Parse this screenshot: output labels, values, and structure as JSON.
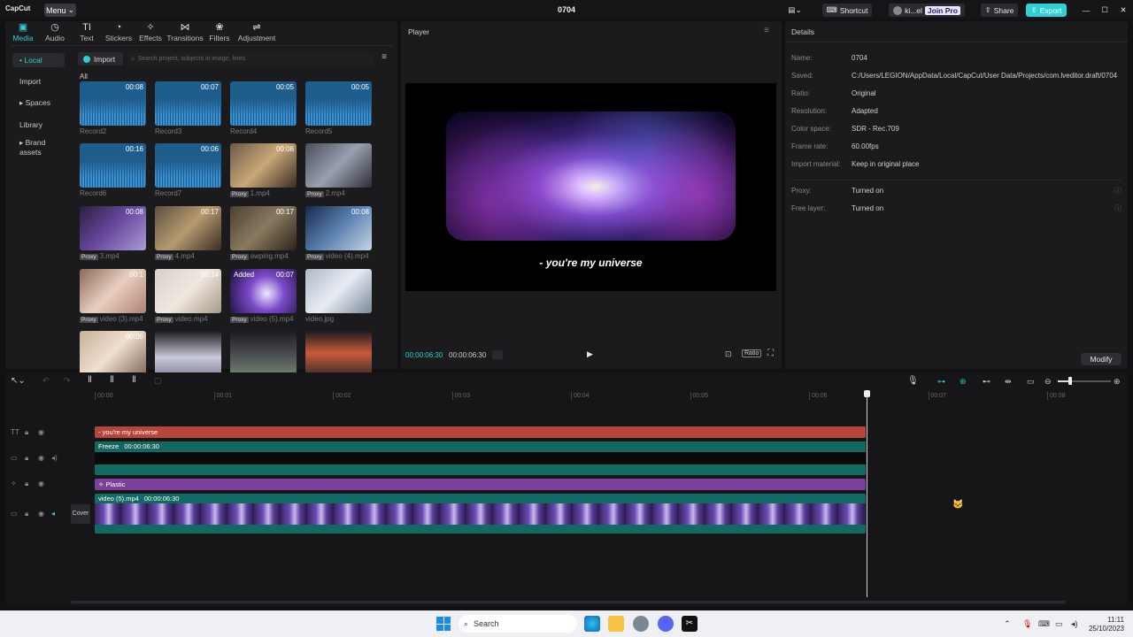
{
  "app": {
    "logo": "CapCut",
    "menu_label": "Menu",
    "project_title": "0704"
  },
  "titlebar": {
    "shortcut": "Shortcut",
    "user": "ki...el",
    "join_pro": "Join Pro",
    "share": "Share",
    "export": "Export"
  },
  "tools": [
    {
      "label": "Media",
      "icon": "media-icon",
      "glyph": "▣"
    },
    {
      "label": "Audio",
      "icon": "audio-icon",
      "glyph": "◷"
    },
    {
      "label": "Text",
      "icon": "text-icon",
      "glyph": "TI"
    },
    {
      "label": "Stickers",
      "icon": "sticker-icon",
      "glyph": "◔"
    },
    {
      "label": "Effects",
      "icon": "effects-icon",
      "glyph": "✧"
    },
    {
      "label": "Transitions",
      "icon": "transitions-icon",
      "glyph": "⋈"
    },
    {
      "label": "Filters",
      "icon": "filters-icon",
      "glyph": "❀"
    },
    {
      "label": "Adjustment",
      "icon": "adjustment-icon",
      "glyph": "⇌"
    }
  ],
  "sidebar": [
    {
      "label": "• Local",
      "active": true
    },
    {
      "label": "Import"
    },
    {
      "label": "▸ Spaces"
    },
    {
      "label": "Library"
    },
    {
      "label": "▸ Brand assets"
    }
  ],
  "media": {
    "import_label": "Import",
    "search_placeholder": "Search project, subjects in image, lines",
    "filter_label": "All",
    "items": [
      {
        "label": "Record2",
        "duration": "00:08",
        "kind": "audio"
      },
      {
        "label": "Record3",
        "duration": "00:07",
        "kind": "audio"
      },
      {
        "label": "Record4",
        "duration": "00:05",
        "kind": "audio"
      },
      {
        "label": "Record5",
        "duration": "00:05",
        "kind": "audio"
      },
      {
        "label": "Record6",
        "duration": "00:16",
        "kind": "audio"
      },
      {
        "label": "Record7",
        "duration": "00:06",
        "kind": "audio"
      },
      {
        "label": "1.mp4",
        "duration": "00:08",
        "kind": "video",
        "proxy": "Proxy"
      },
      {
        "label": "2.mp4",
        "duration": "",
        "kind": "video",
        "proxy": "Proxy"
      },
      {
        "label": "3.mp4",
        "duration": "00:08",
        "kind": "video",
        "proxy": "Proxy"
      },
      {
        "label": "4.mp4",
        "duration": "00:17",
        "kind": "video",
        "proxy": "Proxy"
      },
      {
        "label": "awping.mp4",
        "duration": "00:17",
        "kind": "video",
        "proxy": "Proxy"
      },
      {
        "label": "video (4).mp4",
        "duration": "00:08",
        "kind": "video",
        "proxy": "Proxy"
      },
      {
        "label": "video (3).mp4",
        "duration": "00:1",
        "kind": "video",
        "proxy": "Proxy"
      },
      {
        "label": "video.mp4",
        "duration": "00:14",
        "kind": "video",
        "proxy": "Proxy"
      },
      {
        "label": "video (5).mp4",
        "duration": "00:07",
        "kind": "video",
        "proxy": "Proxy",
        "added": "Added"
      },
      {
        "label": "video.jpg",
        "duration": "",
        "kind": "image"
      },
      {
        "label": "",
        "duration": "00:06",
        "kind": "video"
      },
      {
        "label": "",
        "duration": "",
        "kind": "image"
      },
      {
        "label": "",
        "duration": "",
        "kind": "image"
      },
      {
        "label": "",
        "duration": "",
        "kind": "image"
      }
    ]
  },
  "player": {
    "title": "Player",
    "caption": "- you're my universe",
    "current_time": "00:00:06:30",
    "total_time": "00:00:06:30",
    "ratio_label": "Ratio"
  },
  "details": {
    "title": "Details",
    "rows": [
      {
        "key": "Name:",
        "value": "0704"
      },
      {
        "key": "Saved:",
        "value": "C:/Users/LEGION/AppData/Local/CapCut/User Data/Projects/com.lveditor.draft/0704"
      },
      {
        "key": "Ratio:",
        "value": "Original"
      },
      {
        "key": "Resolution:",
        "value": "Adapted"
      },
      {
        "key": "Color space:",
        "value": "SDR - Rec.709"
      },
      {
        "key": "Frame rate:",
        "value": "60.00fps"
      },
      {
        "key": "Import material:",
        "value": "Keep in original place"
      }
    ],
    "rows2": [
      {
        "key": "Proxy:",
        "value": "Turned on"
      },
      {
        "key": "Free layer:",
        "value": "Turned on"
      }
    ],
    "modify_label": "Modify"
  },
  "timeline": {
    "ticks": [
      "00:00",
      "00:01",
      "00:02",
      "00:03",
      "00:04",
      "00:05",
      "00:06",
      "00:07",
      "00:08"
    ],
    "text_clip": "- you're my universe",
    "freeze_clip": "Freeze",
    "freeze_time": "00:00:06:30",
    "effect_clip": "Plastic",
    "video_clip": "video (5).mp4",
    "video_time": "00:00:06:30",
    "cover_label": "Cover"
  },
  "taskbar": {
    "search_label": "Search",
    "time": "11:11",
    "date": "25/10/2023"
  },
  "colors": {
    "accent": "#2fd0d3",
    "text_track": "#b8453a",
    "freeze_track": "#0f6b63",
    "effect_track": "#7a3f99",
    "video_track": "#0f6b63"
  }
}
